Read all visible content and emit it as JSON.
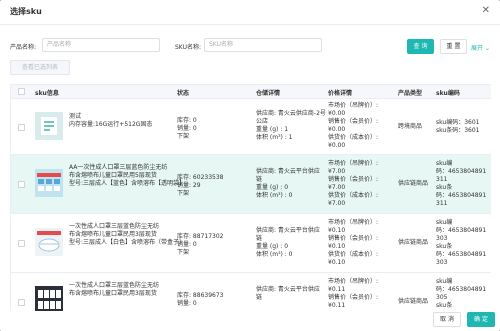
{
  "modal": {
    "title": "选择sku"
  },
  "filters": {
    "product_label": "产品名称:",
    "product_placeholder": "产品名称",
    "sku_label": "SKU名称:",
    "sku_placeholder": "SKU名称",
    "query_label": "查 询",
    "reset_label": "重 置",
    "expand_label": "展开 ⌄",
    "view_selected_label": "查看已选列表"
  },
  "table": {
    "headers": [
      "sku信息",
      "状态",
      "仓储详情",
      "价格详情",
      "产品类型",
      "sku编码"
    ],
    "rows": [
      {
        "name_lines": [
          "测试"
        ],
        "spec": "内存容量:16G运行+512G固态",
        "status": [
          "库存: 0",
          "销量: 0",
          "下架"
        ],
        "storage": [
          "供应商: 青火云供应商-2号",
          "公店",
          "重量 (g) : 1",
          "体积 (m³) : 1"
        ],
        "price": [
          "市场价（吊牌价）:",
          "¥0.00",
          "销售价（会员价）:",
          "¥0.00",
          "供货价（成本价）:",
          "¥0.00"
        ],
        "type": "跨境商品",
        "sku": [
          "sku编码：3601",
          "sku条码：3601"
        ]
      },
      {
        "name_lines": [
          "AA一次性成人口罩三层蓝色防尘无纺",
          "布含熔喷布儿童口罩民用5层现货"
        ],
        "spec": "型号:三层成人【蓝色】含喷溶布【透明袋】",
        "status": [
          "库存: 60233538",
          "销量: 29",
          "下架"
        ],
        "storage": [
          "供应商: 青火云平台供应",
          "链",
          "重量 (g) : 0",
          "体积 (m³) : 0"
        ],
        "price": [
          "市场价（吊牌价）:",
          "¥7.00",
          "销售价（会员价）:",
          "¥7.00",
          "供货价（成本价）:",
          "¥7.00"
        ],
        "type": "供应链商品",
        "sku": [
          "sku编",
          "码：4653804891",
          "311",
          "sku条",
          "码：4653804891",
          "311"
        ]
      },
      {
        "name_lines": [
          "一次性成人口罩三层蓝色防尘无纺",
          "布含熔喷布儿童口罩民用3层现货"
        ],
        "spec": "型号:三层成人【白色】含喷溶布（带盒子）",
        "status": [
          "库存: 88717302",
          "销量: 0",
          "下架"
        ],
        "storage": [
          "供应商: 青火云平台供应",
          "链",
          "重量 (g) : 0",
          "体积 (m³) : 0"
        ],
        "price": [
          "市场价（吊牌价）:",
          "¥0.10",
          "销售价（会员价）:",
          "¥0.10",
          "供货价（成本价）:",
          "¥0.10"
        ],
        "type": "供应链商品",
        "sku": [
          "sku编",
          "码：4653804891",
          "303",
          "sku条",
          "码：4653804891",
          "303"
        ]
      },
      {
        "name_lines": [
          "一次性成人口罩三层蓝色防尘无纺",
          "布含熔喷布儿童口罩民用3层现货"
        ],
        "spec": "",
        "status": [
          "库存: 88639673",
          "销量: 0"
        ],
        "storage": [
          "供应商: 青火云平台供应",
          "链"
        ],
        "price": [
          "市场价（吊牌价）:",
          "¥0.11",
          "销售价（会员价）:",
          "¥0.11"
        ],
        "type": "供应链商品",
        "sku": [
          "sku编",
          "码：4653804891",
          "305",
          "sku条"
        ]
      }
    ]
  },
  "footer": {
    "cancel_label": "取 消",
    "confirm_label": "确 定"
  },
  "colors": {
    "primary": "#1fb7b1",
    "highlight_row": "#e6f7f4"
  }
}
